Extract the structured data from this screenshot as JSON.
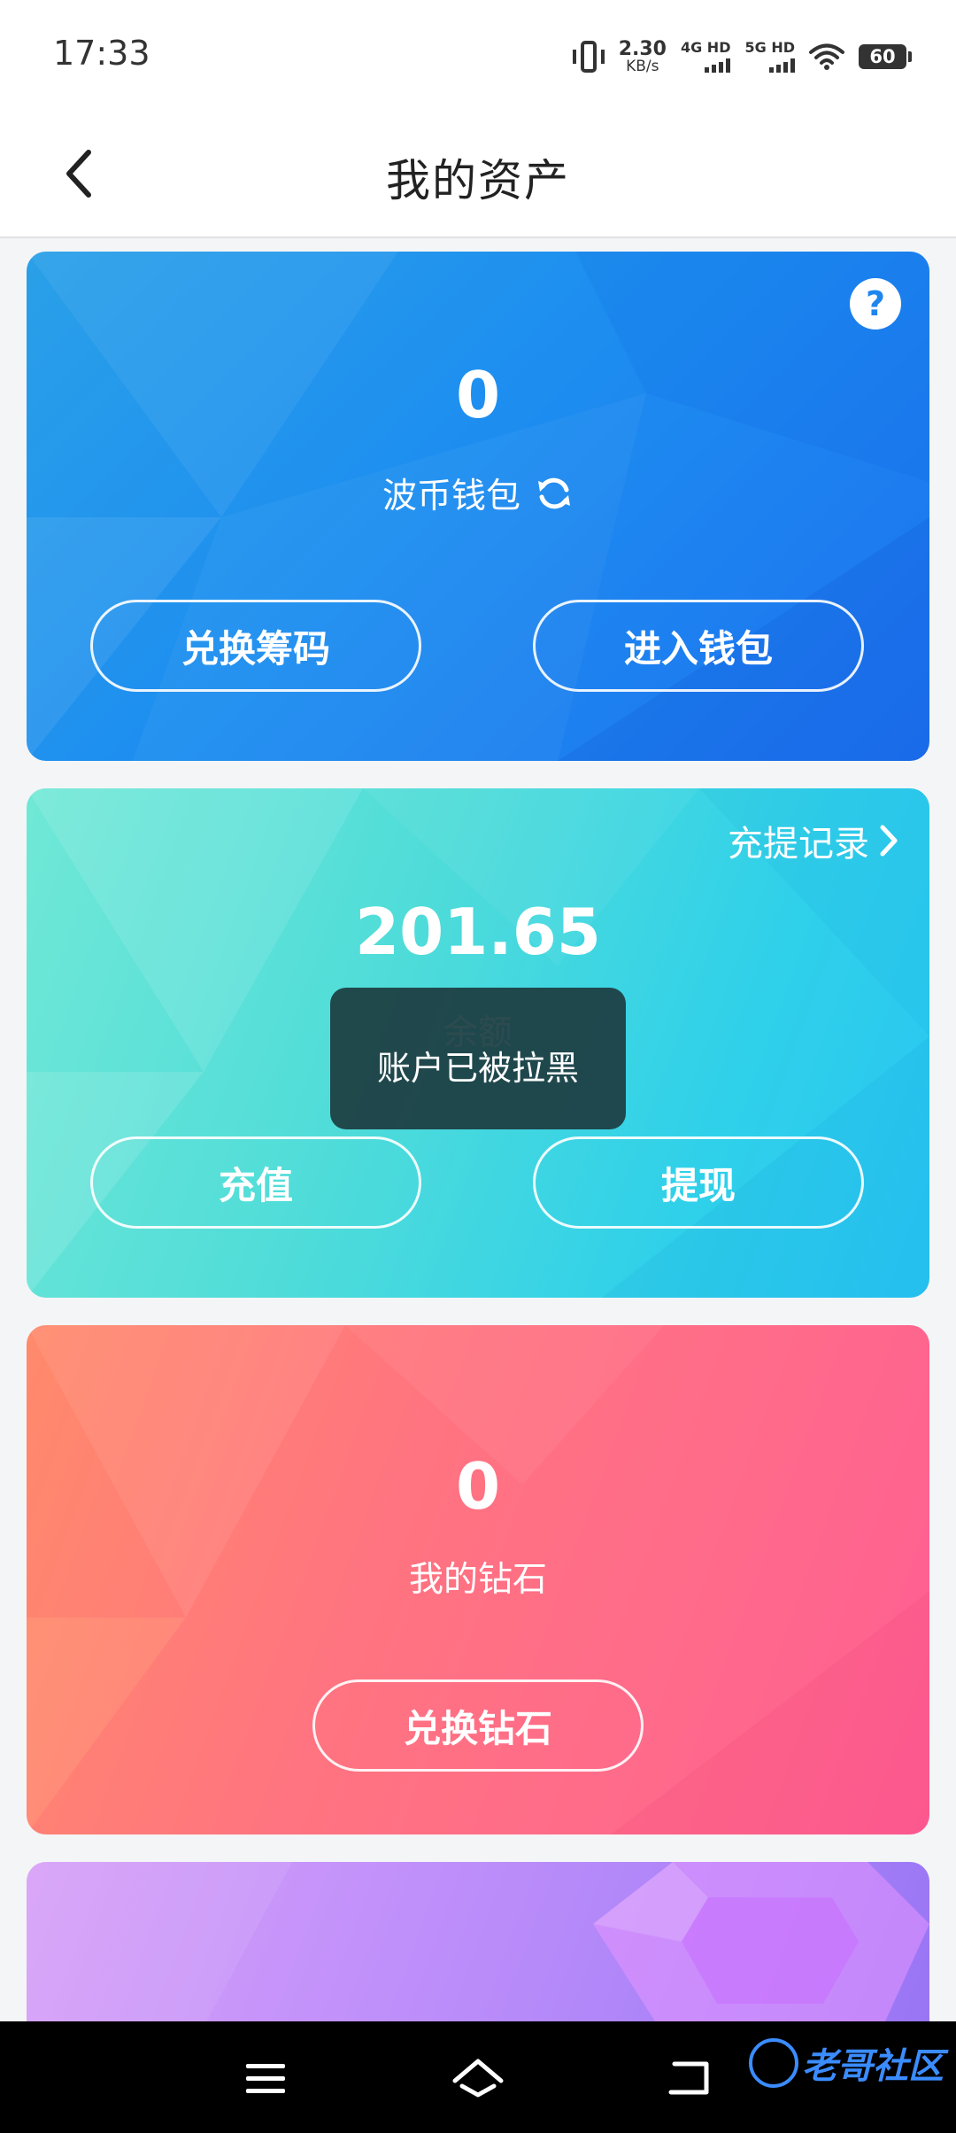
{
  "status_bar": {
    "time": "17:33",
    "speed_value": "2.30",
    "speed_unit": "KB/s",
    "net1_label": "4G HD",
    "net2_label": "5G HD",
    "battery": "60"
  },
  "header": {
    "title": "我的资产"
  },
  "wallet_card": {
    "amount": "0",
    "label": "波币钱包",
    "exchange_chips_label": "兑换筹码",
    "enter_wallet_label": "进入钱包",
    "help_symbol": "?"
  },
  "balance_card": {
    "records_label": "充提记录",
    "amount": "201.65",
    "label": "余额",
    "recharge_label": "充值",
    "withdraw_label": "提现"
  },
  "diamond_card": {
    "amount": "0",
    "label": "我的钻石",
    "exchange_diamond_label": "兑换钻石"
  },
  "toast": {
    "message": "账户已被拉黑"
  },
  "watermark": {
    "text": "老哥社区"
  },
  "colors": {
    "wallet_blue": "#1d8ef0",
    "balance_cyan": "#2fd0ea",
    "diamond_pink": "#ff6b8a",
    "purple": "#b088f8"
  }
}
